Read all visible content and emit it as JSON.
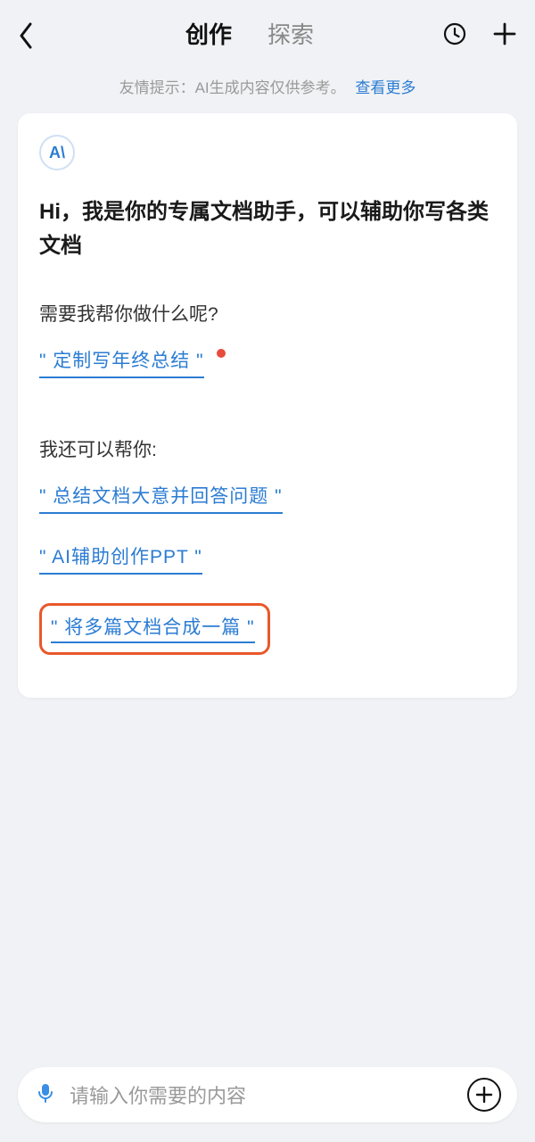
{
  "header": {
    "tabs": {
      "active": "创作",
      "inactive": "探索"
    }
  },
  "tip": {
    "text": "友情提示：AI生成内容仅供参考。",
    "link": "查看更多"
  },
  "card": {
    "avatar_label": "A\\",
    "greeting": "Hi，我是你的专属文档助手，可以辅助你写各类文档",
    "question": "需要我帮你做什么呢?",
    "suggestion_primary": "\" 定制写年终总结 \"",
    "more_label": "我还可以帮你:",
    "suggestions": [
      "\" 总结文档大意并回答问题 \"",
      "\" AI辅助创作PPT \"",
      "\" 将多篇文档合成一篇 \""
    ]
  },
  "input": {
    "placeholder": "请输入你需要的内容"
  }
}
